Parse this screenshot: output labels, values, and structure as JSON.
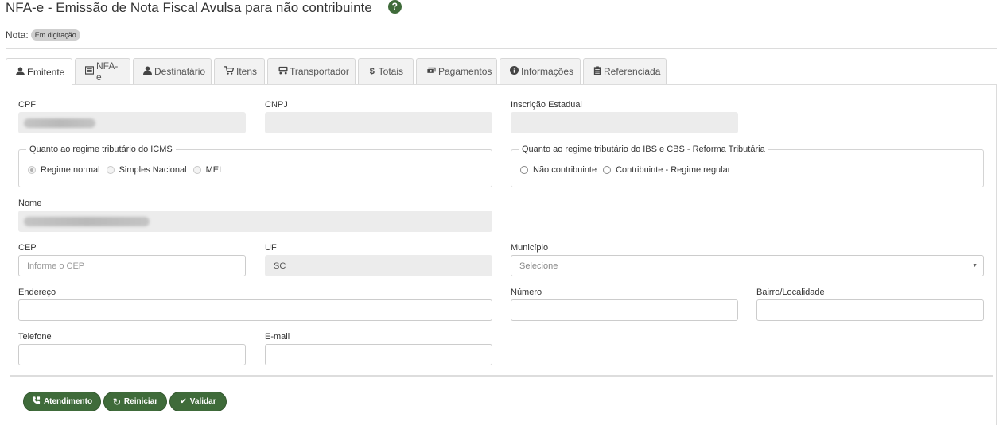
{
  "header": {
    "title": "NFA-e - Emissão de Nota Fiscal Avulsa para não contribuinte",
    "help_icon": "?",
    "nota_label": "Nota:",
    "status_badge": "Em digitação"
  },
  "tabs": [
    {
      "label": "Emitente",
      "icon": "user-icon",
      "glyph": "👤"
    },
    {
      "label": "NFA-e",
      "icon": "document-icon",
      "glyph": "▤"
    },
    {
      "label": "Destinatário",
      "icon": "user-icon",
      "glyph": "👤"
    },
    {
      "label": "Itens",
      "icon": "cart-icon",
      "glyph": "🛒"
    },
    {
      "label": "Transportador",
      "icon": "truck-icon",
      "glyph": "🚚"
    },
    {
      "label": "Totais",
      "icon": "dollar-icon",
      "glyph": "$"
    },
    {
      "label": "Pagamentos",
      "icon": "money-icon",
      "glyph": "💵"
    },
    {
      "label": "Informações",
      "icon": "info-icon",
      "glyph": "ℹ"
    },
    {
      "label": "Referenciada",
      "icon": "clipboard-icon",
      "glyph": "📋"
    }
  ],
  "form": {
    "cpf_label": "CPF",
    "cnpj_label": "CNPJ",
    "ie_label": "Inscrição Estadual",
    "icms": {
      "legend": "Quanto ao regime tributário do ICMS",
      "options": [
        "Regime normal",
        "Simples Nacional",
        "MEI"
      ]
    },
    "ibs": {
      "legend": "Quanto ao regime tributário do IBS e CBS - Reforma Tributária",
      "options": [
        "Não contribuinte",
        "Contribuinte - Regime regular"
      ]
    },
    "nome_label": "Nome",
    "cep_label": "CEP",
    "cep_placeholder": "Informe o CEP",
    "uf_label": "UF",
    "uf_value": "SC",
    "municipio_label": "Município",
    "municipio_placeholder": "Selecione",
    "endereco_label": "Endereço",
    "numero_label": "Número",
    "bairro_label": "Bairro/Localidade",
    "telefone_label": "Telefone",
    "email_label": "E-mail"
  },
  "buttons": {
    "atendimento": "Atendimento",
    "reiniciar": "Reiniciar",
    "validar": "Validar"
  }
}
